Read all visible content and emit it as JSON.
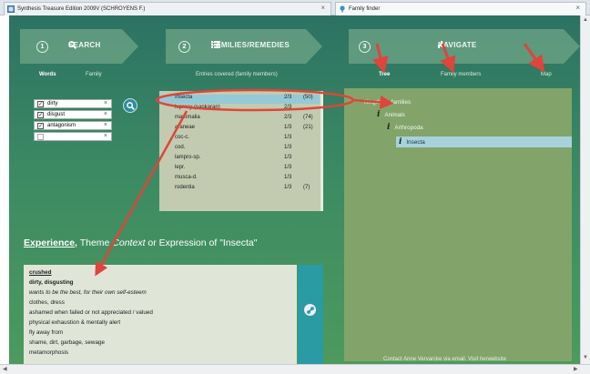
{
  "tabs": [
    {
      "title": "Synthesis Treasure Edition 2009V (SCHROYENS F.)",
      "close": "×"
    },
    {
      "title": "Family finder",
      "close": "×"
    }
  ],
  "steps": [
    {
      "num": "1",
      "label": "SEARCH",
      "icon": "search-icon"
    },
    {
      "num": "2",
      "label": "FAMILIES/REMEDIES",
      "icon": "list-icon"
    },
    {
      "num": "3",
      "label": "NAVIGATE",
      "icon": "navigate-icon"
    }
  ],
  "subnav": {
    "words": "Words",
    "family": "Family",
    "entries_covered": "Entries covered (family members)",
    "tree": "Tree",
    "family_members": "Family members",
    "map": "Map"
  },
  "words": [
    {
      "text": "dirty",
      "checked": true
    },
    {
      "text": "disgust",
      "checked": true
    },
    {
      "text": "antagonism",
      "checked": true
    },
    {
      "text": "",
      "checked": false
    }
  ],
  "word_remove": "×",
  "entries": [
    {
      "name": "Insecta",
      "frac": "2/3",
      "count": "(50)",
      "selected": true
    },
    {
      "name": "leprosy (sankaran)",
      "frac": "2/3",
      "count": "",
      "selected": false
    },
    {
      "name": "mammalia",
      "frac": "2/3",
      "count": "(74)",
      "selected": false
    },
    {
      "name": "araneae",
      "frac": "1/3",
      "count": "(21)",
      "selected": false
    },
    {
      "name": "coc-c.",
      "frac": "1/3",
      "count": "",
      "selected": false
    },
    {
      "name": "cod.",
      "frac": "1/3",
      "count": "",
      "selected": false
    },
    {
      "name": "lampro-sp.",
      "frac": "1/3",
      "count": "",
      "selected": false
    },
    {
      "name": "lepr.",
      "frac": "1/3",
      "count": "",
      "selected": false
    },
    {
      "name": "musca-d.",
      "frac": "1/3",
      "count": "",
      "selected": false
    },
    {
      "name": "rodentia",
      "frac": "1/3",
      "count": "(7)",
      "selected": false
    }
  ],
  "tree": [
    {
      "label": "Kingdoms families",
      "level": 0,
      "info": false,
      "selected": false
    },
    {
      "label": "Animals",
      "level": 1,
      "info": true,
      "selected": false
    },
    {
      "label": "Arthropoda",
      "level": 2,
      "info": true,
      "selected": false
    },
    {
      "label": "Insecta",
      "level": 3,
      "info": true,
      "selected": true
    }
  ],
  "experience": {
    "heading_bold": "Experience,",
    "heading_theme": "Theme",
    "heading_italic": "Context",
    "heading_rest": "or Expression of \"Insecta\""
  },
  "experience_items": [
    {
      "text": "crushed",
      "style": "bold-underline"
    },
    {
      "text": "dirty, disgusting",
      "style": "bold"
    },
    {
      "text": "wants to be the best, for their own self-esteem",
      "style": "italic"
    },
    {
      "text": "clothes, dress",
      "style": "normal"
    },
    {
      "text": "ashamed when failed or not appreciated / valued",
      "style": "normal"
    },
    {
      "text": "physical exhaustion & mentally alert",
      "style": "normal"
    },
    {
      "text": "fly away from",
      "style": "normal"
    },
    {
      "text": "shame, dirt, garbage, sewage",
      "style": "normal"
    },
    {
      "text": "metamorphosis",
      "style": "normal"
    }
  ],
  "contact": "Contact Anne Vervarcke via email. Visit herwebsite",
  "colors": {
    "app_bg_top": "#2c7263",
    "app_bg_bottom": "#4c9a5e",
    "selection": "#95c9d6",
    "annotation": "#e0443a",
    "teal_button": "#2e8f9a"
  }
}
